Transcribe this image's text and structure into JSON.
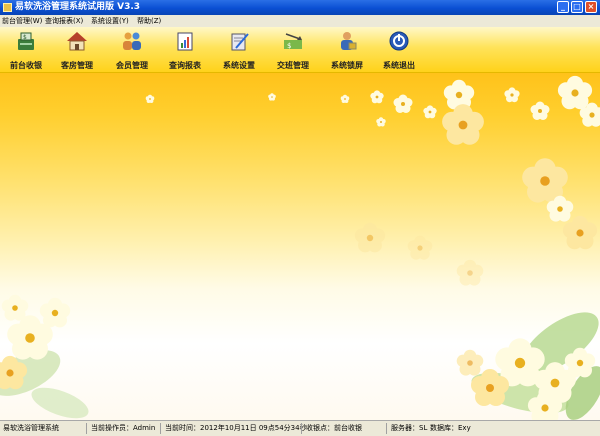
{
  "window": {
    "title": "易软洗浴管理系统试用版 V3.3"
  },
  "menu": [
    "前台管理(W)",
    "查询报表(X)",
    "系统设置(Y)",
    "帮助(Z)"
  ],
  "toolbar": [
    {
      "label": "前台收银",
      "icon": "cash-register-icon"
    },
    {
      "label": "客房管理",
      "icon": "house-icon"
    },
    {
      "label": "会员管理",
      "icon": "members-icon"
    },
    {
      "label": "查询报表",
      "icon": "report-icon"
    },
    {
      "label": "系统设置",
      "icon": "settings-icon"
    },
    {
      "label": "交班管理",
      "icon": "handover-icon"
    },
    {
      "label": "系统锁屏",
      "icon": "lock-screen-icon"
    },
    {
      "label": "系统退出",
      "icon": "exit-icon"
    }
  ],
  "status": {
    "app": "易软洗浴管理系统",
    "operator": "当前操作员：Admin",
    "time": "当前时间：2012年10月11日 09点54分34秒",
    "station": "收银点：前台收银",
    "server": "服务器：SL",
    "database": "数据库：Exy"
  }
}
